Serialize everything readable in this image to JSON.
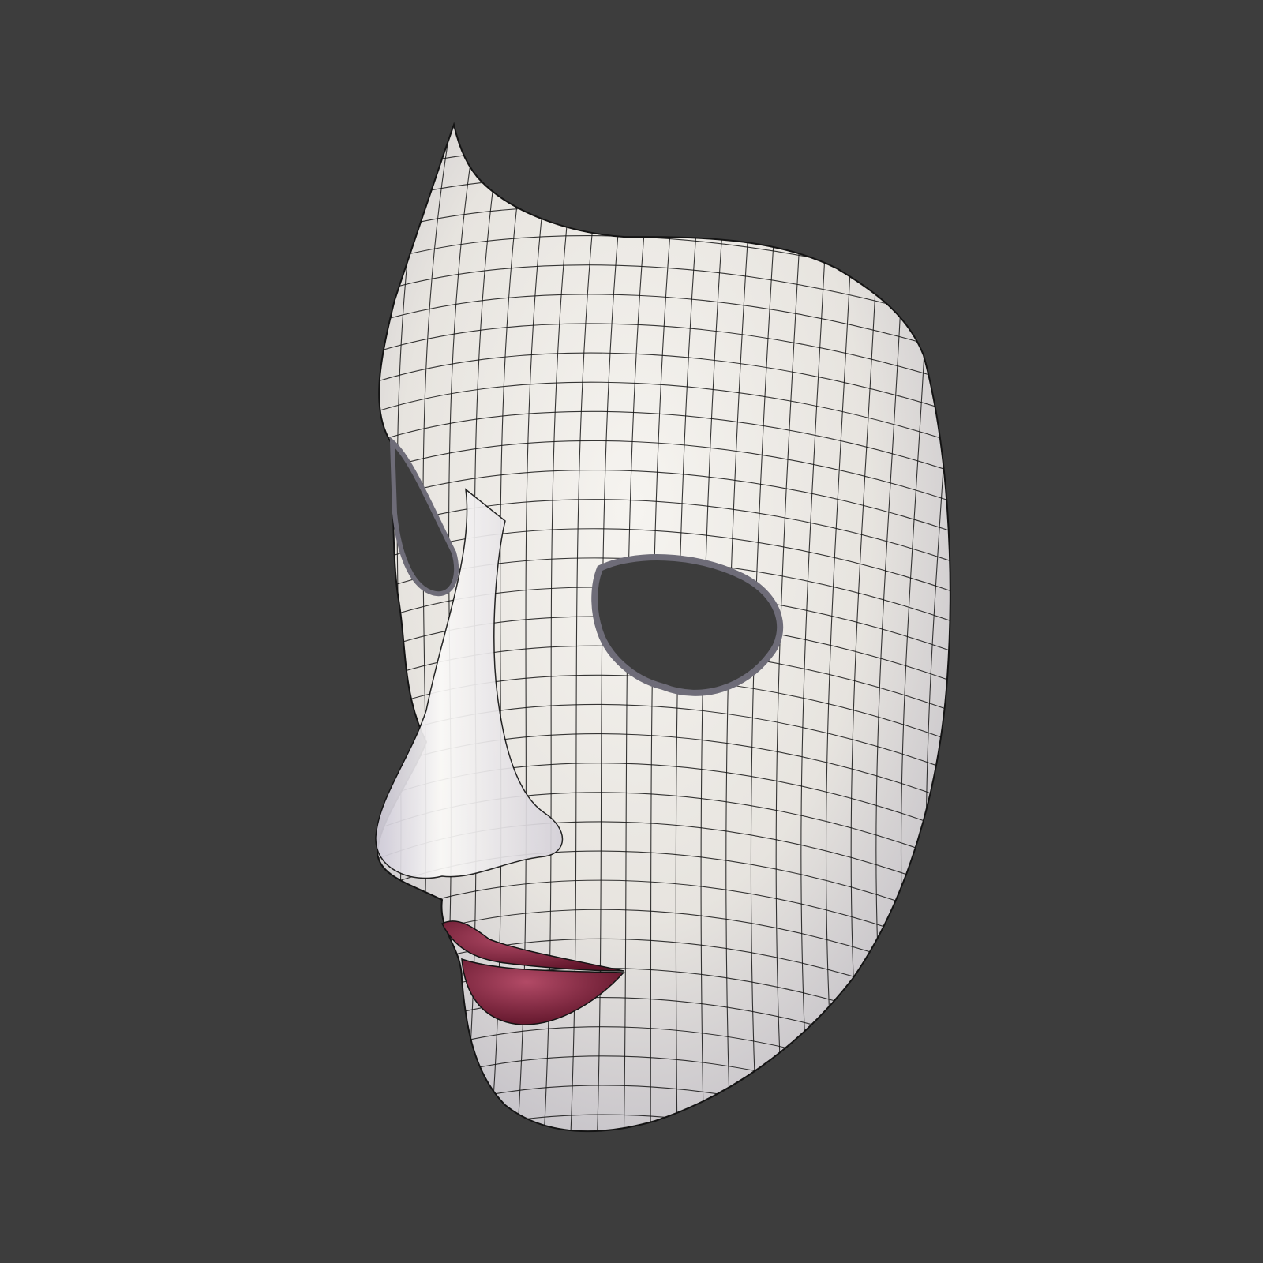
{
  "viewport": {
    "background_color": "#3d3d3d"
  },
  "model": {
    "name": "mask-mesh",
    "base_color": "#ece9e3",
    "shadow_color": "#a9a6b2",
    "wire_color": "#141414",
    "lip_color": "#7a1f38",
    "lip_highlight": "#b24a66",
    "eye_hole_color": "#3d3d3d",
    "cheek_tint": "#d7c2c6"
  }
}
